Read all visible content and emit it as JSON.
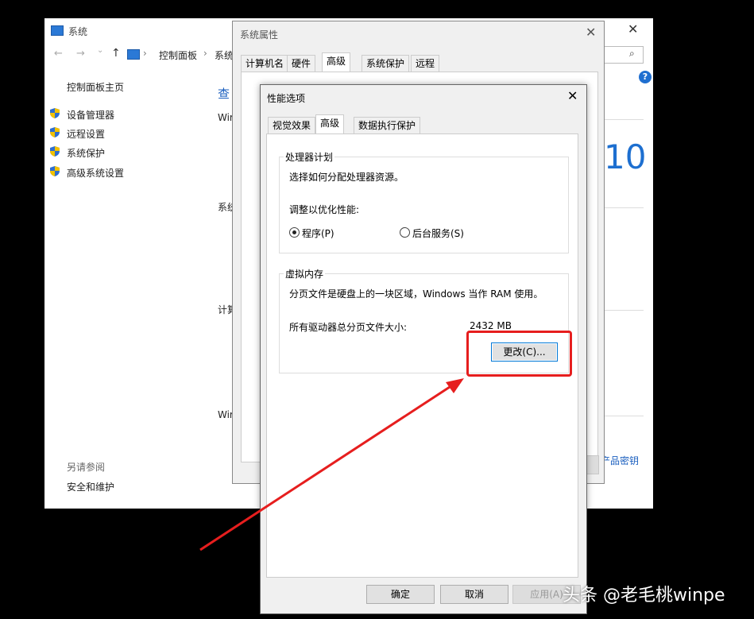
{
  "system_window": {
    "title": "系统",
    "nav": {
      "back": "←",
      "forward": "→",
      "dropdown": "⌄",
      "up": "↑",
      "breadcrumb": [
        "控制面板",
        "系统"
      ]
    },
    "sidebar": {
      "home": "控制面板主页",
      "items": [
        "设备管理器",
        "远程设置",
        "系统保护",
        "高级系统设置"
      ],
      "see_also_heading": "另请参阅",
      "see_also_items": [
        "安全和维护"
      ]
    },
    "main": {
      "heading_partial": "查",
      "labels": [
        "Wir",
        "系统",
        "计算",
        "Wir"
      ],
      "win10_fragment": "10",
      "product_key_fragment": "产品密钥"
    }
  },
  "system_properties": {
    "title": "系统属性",
    "tabs": [
      "计算机名",
      "硬件",
      "高级",
      "系统保护",
      "远程"
    ],
    "active_tab": "高级"
  },
  "performance_options": {
    "title": "性能选项",
    "tabs": [
      "视觉效果",
      "高级",
      "数据执行保护"
    ],
    "active_tab": "高级",
    "processor": {
      "legend": "处理器计划",
      "description": "选择如何分配处理器资源。",
      "adjust_label": "调整以优化性能:",
      "options": [
        {
          "label": "程序(P)",
          "selected": true
        },
        {
          "label": "后台服务(S)",
          "selected": false
        }
      ]
    },
    "virtual_memory": {
      "legend": "虚拟内存",
      "description": "分页文件是硬盘上的一块区域，Windows 当作 RAM 使用。",
      "total_label": "所有驱动器总分页文件大小:",
      "total_value": "2432 MB",
      "change_button": "更改(C)..."
    },
    "buttons": {
      "ok": "确定",
      "cancel": "取消",
      "apply": "应用(A)"
    }
  },
  "watermark": "头条 @老毛桃winpe",
  "colors": {
    "highlight": "#e61e1e",
    "accent": "#0078d7",
    "arrow": "#e61e1e"
  }
}
